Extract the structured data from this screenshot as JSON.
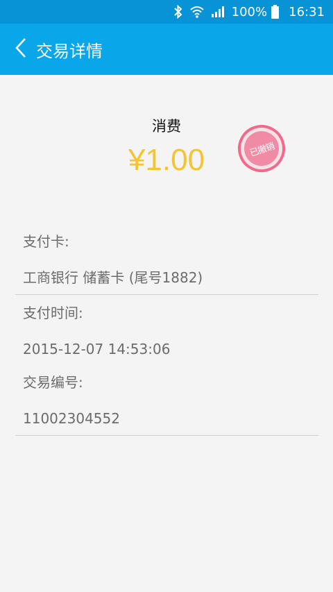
{
  "status_bar": {
    "battery_percent": "100%",
    "time": "16:31",
    "icons": [
      "bluetooth-icon",
      "wifi-icon",
      "signal-icon",
      "battery-icon"
    ]
  },
  "app_bar": {
    "back_icon": "chevron-left-icon",
    "title": "交易详情"
  },
  "transaction": {
    "type": "消费",
    "amount": "¥1.00",
    "stamp_text": "已撤销"
  },
  "details": {
    "card_label": "支付卡:",
    "card_value": "工商银行 储蓄卡 (尾号1882)",
    "time_label": "支付时间:",
    "time_value": "2015-12-07 14:53:06",
    "number_label": "交易编号:",
    "number_value": "11002304552"
  },
  "colors": {
    "status_bar": "#0893d6",
    "app_bar": "#09a6ea",
    "amount": "#f4c433",
    "stamp": "#ef6a8c",
    "background": "#f4f4f4"
  }
}
